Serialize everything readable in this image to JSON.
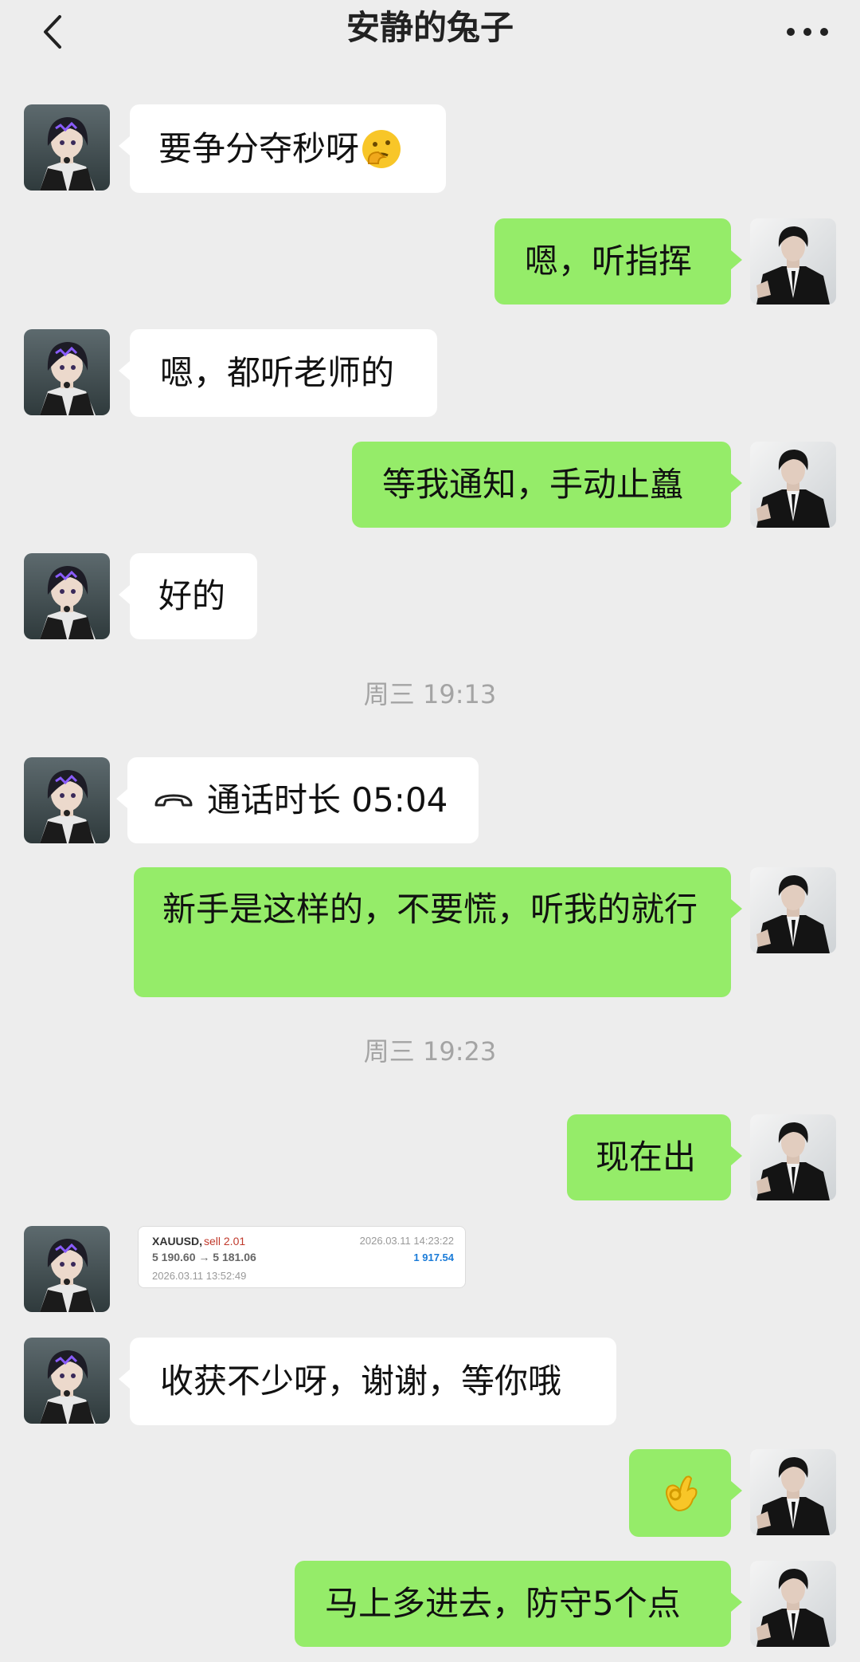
{
  "header": {
    "title": "安静的兔子",
    "back_icon": "chevron-left-icon",
    "more_icon": "more-dots-icon"
  },
  "messages": [
    {
      "from": "contact",
      "text": "要争分夺秒呀",
      "emoji": "thinking-face"
    },
    {
      "from": "me",
      "text": "嗯，听指挥"
    },
    {
      "from": "contact",
      "text": "嗯，都听老师的"
    },
    {
      "from": "me",
      "text": "等我通知，手动止蠤"
    },
    {
      "from": "contact",
      "text": "好的"
    },
    {
      "time": "周三 19:13"
    },
    {
      "from": "contact",
      "call": "通话时长 05:04",
      "icon": "phone-hangup-icon"
    },
    {
      "from": "me",
      "text": "新手是这样的，不要慌，听我的就行"
    },
    {
      "time": "周三 19:23"
    },
    {
      "from": "me",
      "text": "现在出"
    },
    {
      "from": "contact",
      "card": "trade"
    },
    {
      "from": "contact",
      "text": "收获不少呀，谢谢，等你哦"
    },
    {
      "from": "me",
      "emoji": "ok-hand"
    },
    {
      "from": "me",
      "text": "马上多进去，防守5个点"
    }
  ],
  "trade": {
    "symbol": "XAUUSD,",
    "side": "sell 2.01",
    "prices": "5 190.60 → 5 181.06",
    "open_time": "2026.03.11 13:52:49",
    "close_time": "2026.03.11 14:23:22",
    "profit": "1 917.54"
  },
  "colors": {
    "bubble_me": "#95ec69",
    "bubble_contact": "#ffffff",
    "background": "#ededed",
    "sell": "#c0392b",
    "profit": "#1a7bd8"
  }
}
